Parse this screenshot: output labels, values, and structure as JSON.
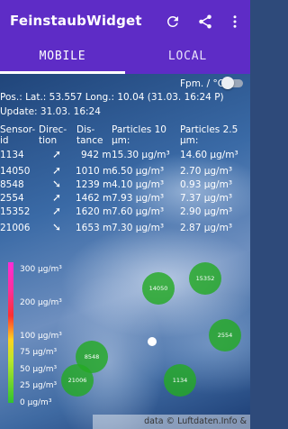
{
  "app": {
    "title": "FeinstaubWidget"
  },
  "tabs": [
    {
      "label": "MOBILE"
    },
    {
      "label": "LOCAL"
    }
  ],
  "toggle": {
    "label": "Fpm. / °C"
  },
  "position": {
    "text": "Pos.: Lat.: 53.557 Long.: 10.04 (31.03. 16:24 P)",
    "update": "Update: 31.03. 16:24"
  },
  "table": {
    "headers": {
      "sensor_l1": "Sensor-",
      "sensor_l2": "id",
      "direction_l1": "Direc-",
      "direction_l2": "tion",
      "distance_l1": "Dis-",
      "distance_l2": "tance",
      "p10_l1": "Particles 10",
      "p10_l2": "µm:",
      "p25_l1": "Particles 2.5",
      "p25_l2": "µm:"
    },
    "rows": [
      {
        "id": "1134",
        "dir": "➚",
        "distance": "942 m",
        "p10": "15.30 µg/m³",
        "p25": "14.60 µg/m³"
      },
      {
        "id": "14050",
        "dir": "➚",
        "distance": "1010 m",
        "p10": "6.50 µg/m³",
        "p25": "2.70 µg/m³"
      },
      {
        "id": "8548",
        "dir": "➘",
        "distance": "1239 m",
        "p10": "4.10 µg/m³",
        "p25": "0.93 µg/m³"
      },
      {
        "id": "2554",
        "dir": "➚",
        "distance": "1462 m",
        "p10": "7.93 µg/m³",
        "p25": "7.37 µg/m³"
      },
      {
        "id": "15352",
        "dir": "➚",
        "distance": "1620 m",
        "p10": "7.60 µg/m³",
        "p25": "2.90 µg/m³"
      },
      {
        "id": "21006",
        "dir": "➘",
        "distance": "1653 m",
        "p10": "7.30 µg/m³",
        "p25": "2.87 µg/m³"
      }
    ]
  },
  "scale": {
    "labels": [
      "300 µg/m³",
      "200 µg/m³",
      "100 µg/m³",
      "75 µg/m³",
      "50 µg/m³",
      "25 µg/m³",
      "0 µg/m³"
    ]
  },
  "markers": [
    {
      "label": "14050"
    },
    {
      "label": "15352"
    },
    {
      "label": "2554"
    },
    {
      "label": "8548"
    },
    {
      "label": "21006"
    },
    {
      "label": "1134"
    }
  ],
  "attribution": "data © Luftdaten.Info & contributors"
}
